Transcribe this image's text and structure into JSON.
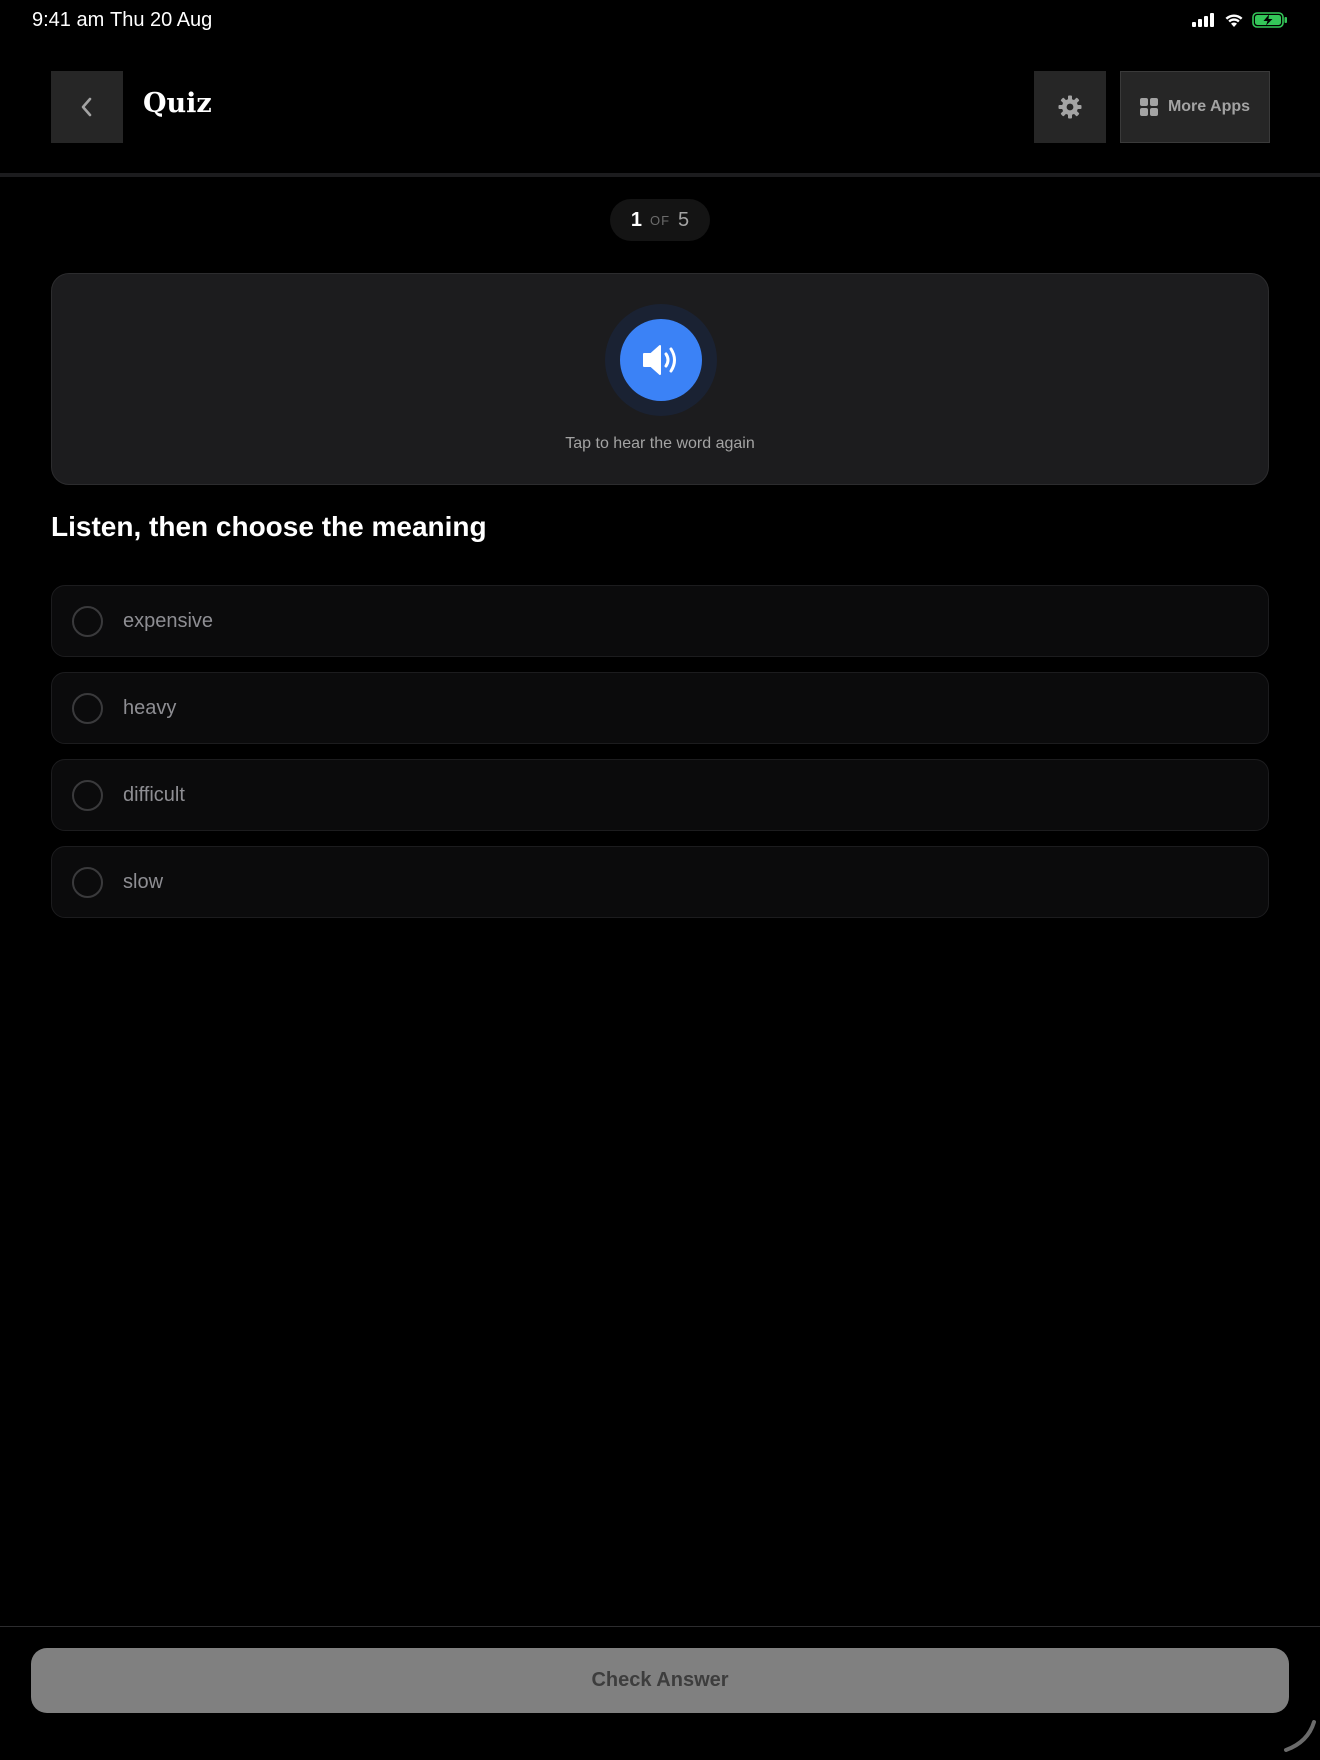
{
  "status_bar": {
    "time": "9:41 am",
    "date": "Thu 20 Aug",
    "battery_color": "#34c759"
  },
  "header": {
    "title": "Quiz",
    "back_icon": "chevron-left-icon",
    "settings_icon": "gear-icon",
    "more_apps_icon": "grid-icon",
    "more_apps_label": "More Apps"
  },
  "progress": {
    "current": "1",
    "of_label": "OF",
    "total": "5"
  },
  "audio_card": {
    "icon": "speaker-icon",
    "accent_color": "#3b82f6",
    "hint": "Tap to hear the word again"
  },
  "question": {
    "title": "Listen, then choose the meaning"
  },
  "options": [
    {
      "label": "expensive",
      "selected": false
    },
    {
      "label": "heavy",
      "selected": false
    },
    {
      "label": "difficult",
      "selected": false
    },
    {
      "label": "slow",
      "selected": false
    }
  ],
  "footer": {
    "check_answer_label": "Check Answer",
    "disabled": true
  }
}
